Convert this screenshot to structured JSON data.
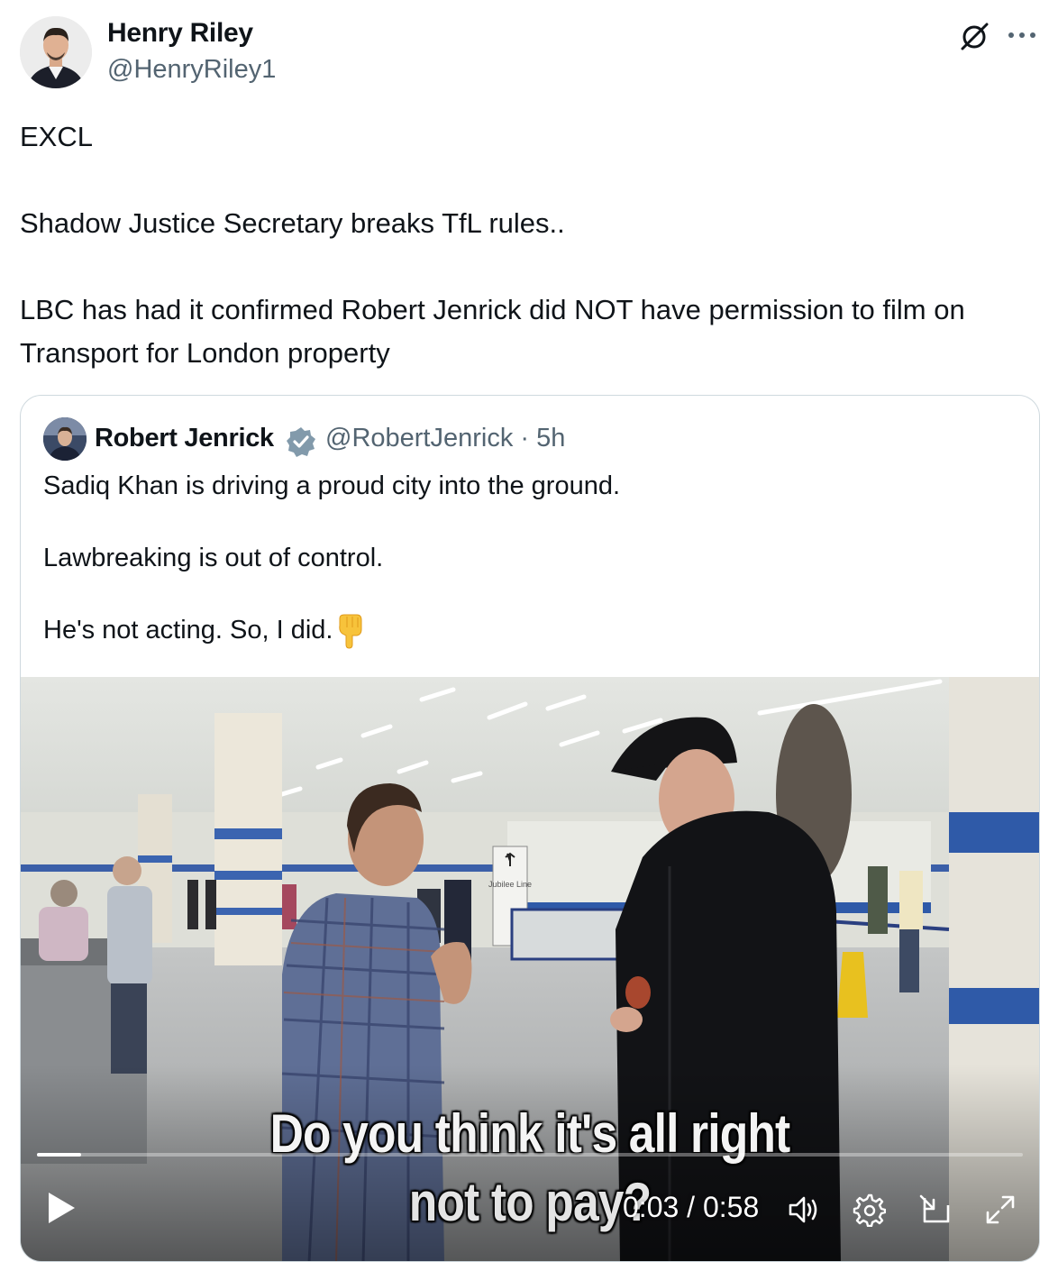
{
  "post": {
    "author_name": "Henry Riley",
    "author_handle": "@HenryRiley1",
    "text_lines": [
      "EXCL",
      "Shadow Justice Secretary breaks TfL rules..",
      "LBC has had it confirmed Robert Jenrick did NOT have permission to film on Transport for London property"
    ],
    "icons": {
      "grok": "grok-icon",
      "more": "more-options-icon",
      "avatar": "avatar"
    }
  },
  "quote": {
    "author_name": "Robert Jenrick",
    "author_handle": "@RobertJenrick",
    "separator": "·",
    "time_ago": "5h",
    "verified": true,
    "verified_color": "#829aab",
    "text_lines": [
      "Sadiq Khan is driving a proud city into the ground.",
      "Lawbreaking is out of control.",
      "He's not acting. So, I did."
    ],
    "emoji": "backhand-index-pointing-down"
  },
  "video": {
    "subtitle_line1": "Do you think it's all right",
    "subtitle_line2": "not to pay?",
    "sign_text": "Jubilee Line",
    "current_time": "0:03",
    "time_separator": "/",
    "duration": "0:58",
    "progress_fraction": 0.045,
    "controls": [
      "play-icon",
      "volume-icon",
      "settings-gear-icon",
      "picture-in-picture-icon",
      "fullscreen-icon"
    ]
  }
}
